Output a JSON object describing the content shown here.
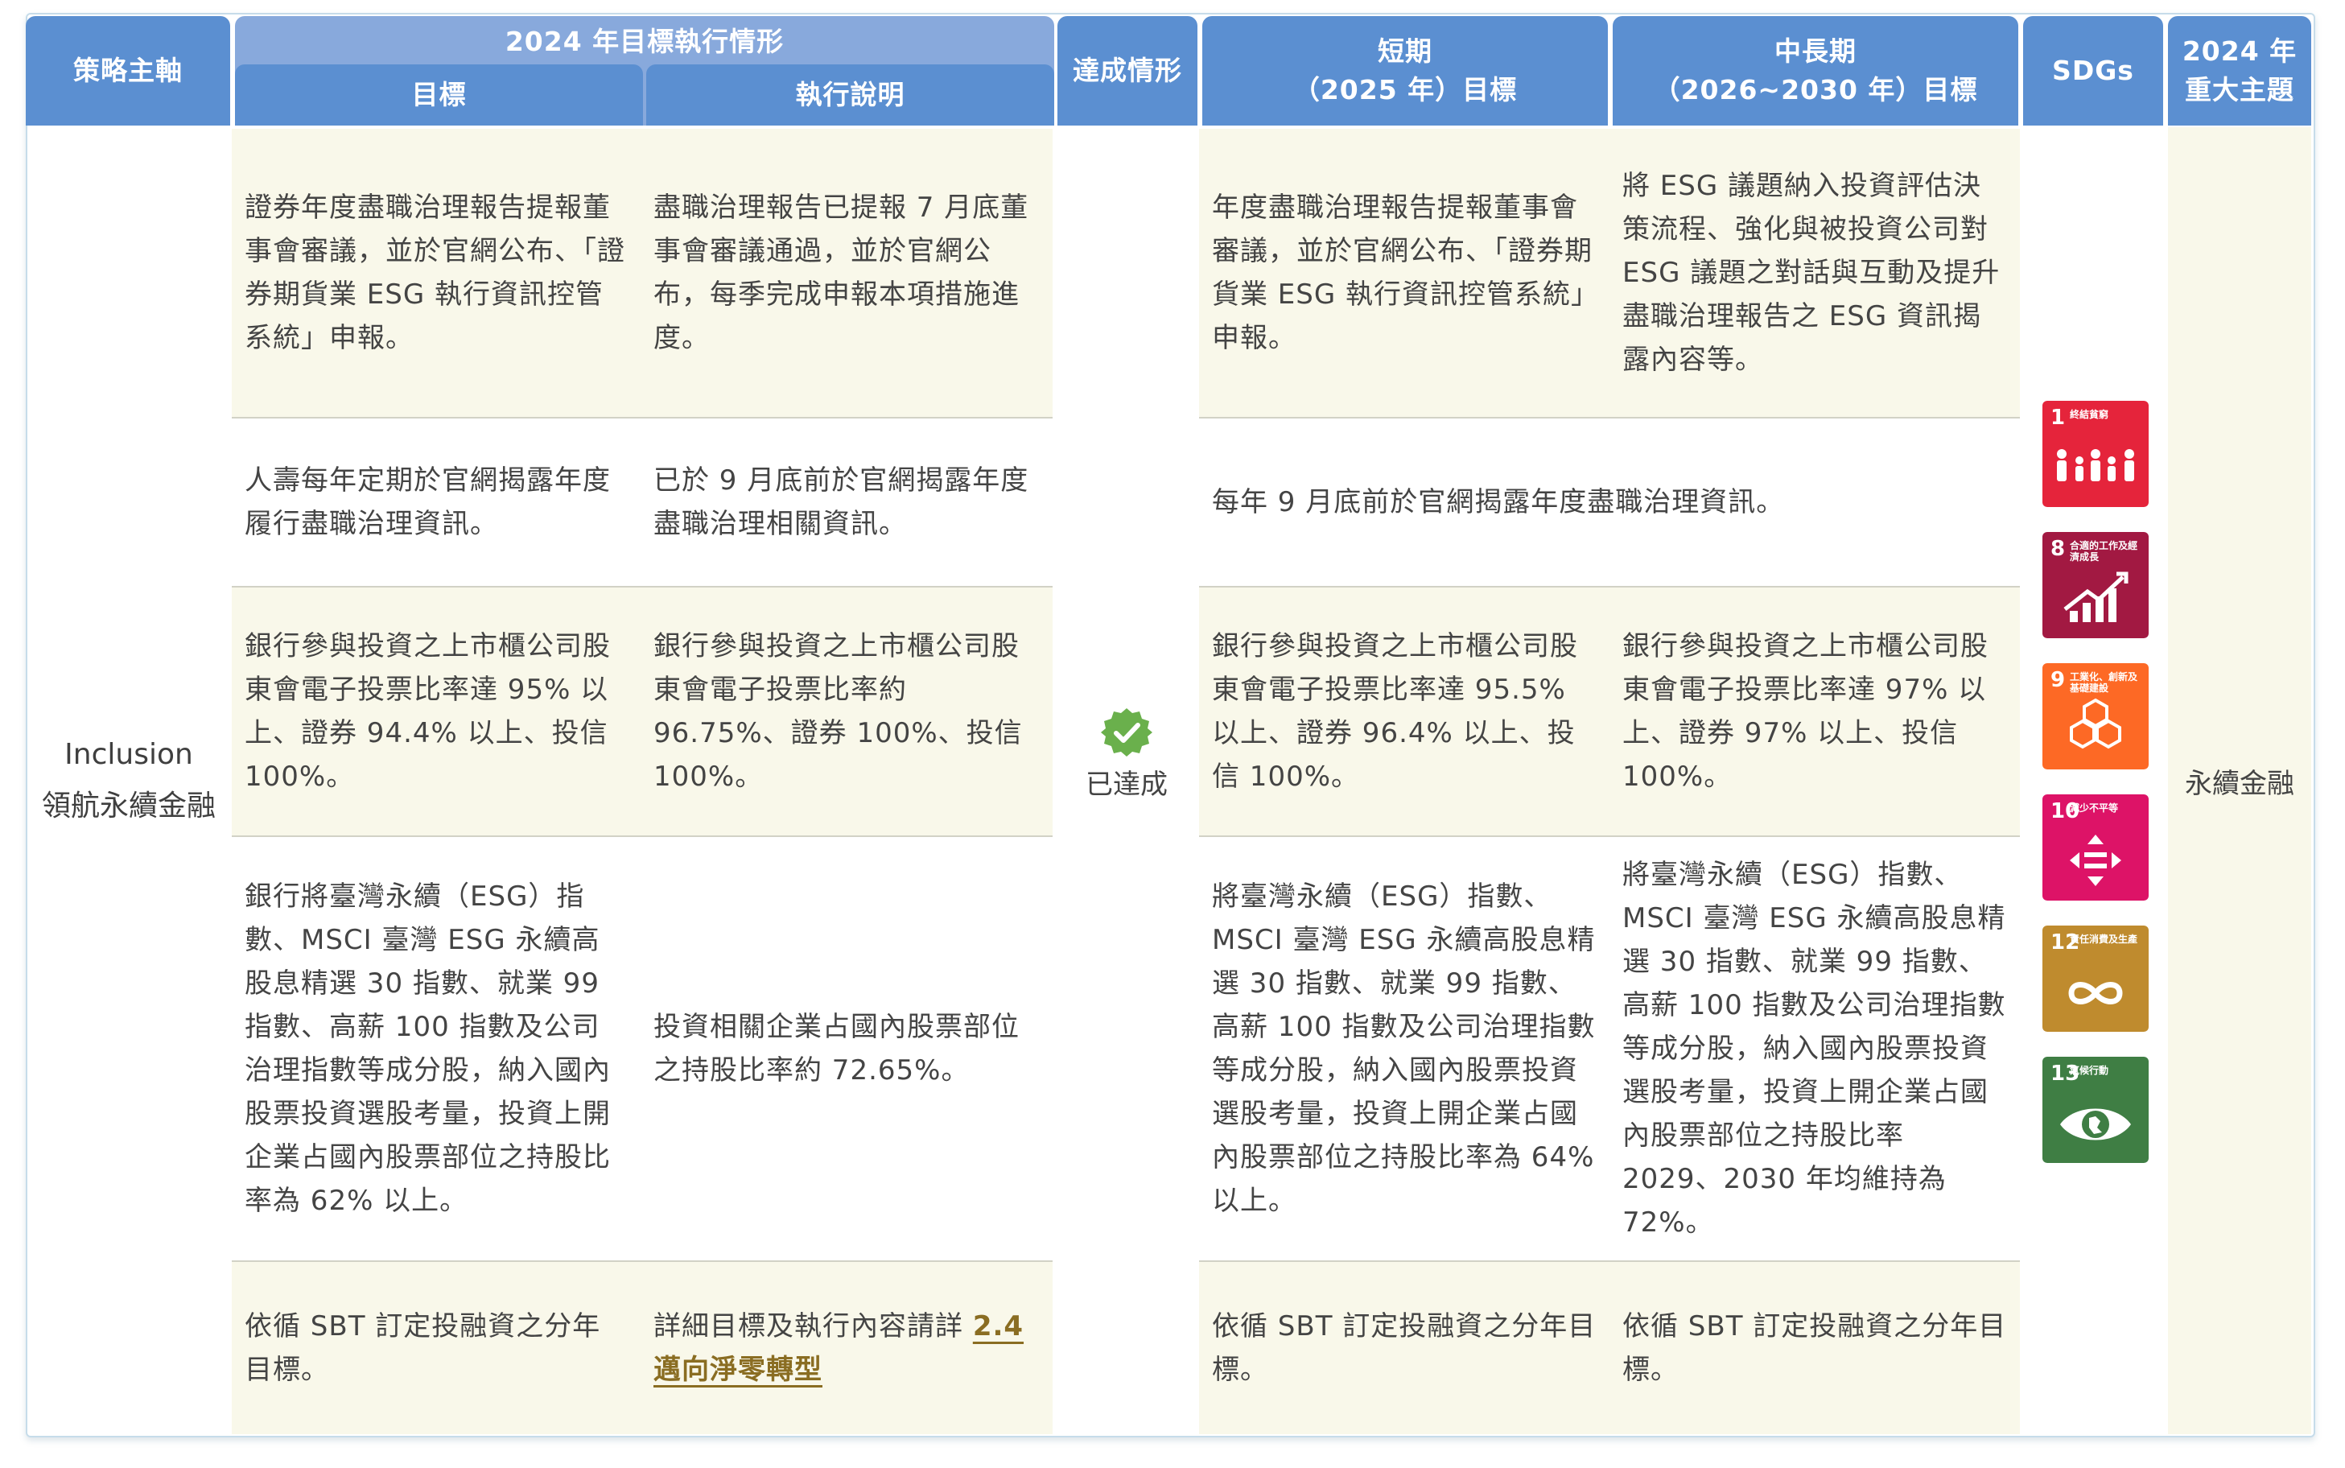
{
  "headers": {
    "axis": "策略主軸",
    "group_2024": "2024 年目標執行情形",
    "target": "目標",
    "execution": "執行說明",
    "achievement": "達成情形",
    "short_term": "短期\n（2025 年）目標",
    "long_term": "中長期\n（2026~2030 年）目標",
    "sdgs": "SDGs",
    "theme": "2024 年\n重大主題"
  },
  "axis": {
    "en": "Inclusion",
    "zh": "領航永續金融"
  },
  "achievement": {
    "label": "已達成",
    "icon": "check-badge-icon",
    "color": "#6ab04c"
  },
  "theme": "永續金融",
  "rows": [
    {
      "target": "證券年度盡職治理報告提報董事會審議，並於官網公布、「證券期貨業 ESG 執行資訊控管系統」申報。",
      "execution": "盡職治理報告已提報 7 月底董事會審議通過，並於官網公布，每季完成申報本項措施進度。",
      "short": "年度盡職治理報告提報董事會審議，並於官網公布、「證券期貨業 ESG 執行資訊控管系統」申報。",
      "long": "將 ESG 議題納入投資評估決策流程、強化與被投資公司對 ESG 議題之對話與互動及提升盡職治理報告之 ESG 資訊揭露內容等。"
    },
    {
      "target": "人壽每年定期於官網揭露年度履行盡職治理資訊。",
      "execution": "已於 9 月底前於官網揭露年度盡職治理相關資訊。",
      "merged": "每年 9 月底前於官網揭露年度盡職治理資訊。"
    },
    {
      "target": "銀行參與投資之上市櫃公司股東會電子投票比率達 95% 以上、證券 94.4% 以上、投信 100%。",
      "execution": "銀行參與投資之上市櫃公司股東會電子投票比率約 96.75%、證券 100%、投信 100%。",
      "short": "銀行參與投資之上市櫃公司股東會電子投票比率達 95.5% 以上、證券 96.4% 以上、投信 100%。",
      "long": "銀行參與投資之上市櫃公司股東會電子投票比率達 97% 以上、證券 97% 以上、投信 100%。"
    },
    {
      "target": "銀行將臺灣永續（ESG）指數、MSCI 臺灣 ESG 永續高股息精選 30 指數、就業 99 指數、高薪 100 指數及公司治理指數等成分股，納入國內股票投資選股考量，投資上開企業占國內股票部位之持股比率為 62% 以上。",
      "execution": "投資相關企業占國內股票部位之持股比率約 72.65%。",
      "short": "將臺灣永續（ESG）指數、MSCI 臺灣 ESG 永續高股息精選 30 指數、就業 99 指數、高薪 100 指數及公司治理指數等成分股，納入國內股票投資選股考量，投資上開企業占國內股票部位之持股比率為 64% 以上。",
      "long": "將臺灣永續（ESG）指數、MSCI 臺灣 ESG 永續高股息精選 30 指數、就業 99 指數、高薪 100 指數及公司治理指數等成分股，納入國內股票投資選股考量，投資上開企業占國內股票部位之持股比率 2029、2030 年均維持為 72%。"
    },
    {
      "target": "依循 SBT 訂定投融資之分年目標。",
      "execution_prefix": "詳細目標及執行內容請詳 ",
      "execution_link": "2.4 邁向淨零轉型",
      "short": "依循 SBT 訂定投融資之分年目標。",
      "long": "依循 SBT 訂定投融資之分年目標。"
    }
  ],
  "sdgs": [
    {
      "num": "1",
      "label": "終結貧窮",
      "color": "#e5243b",
      "icon": "people-icon"
    },
    {
      "num": "8",
      "label": "合適的工作及經濟成長",
      "color": "#a21942",
      "icon": "growth-chart-icon"
    },
    {
      "num": "9",
      "label": "工業化、創新及基礎建設",
      "color": "#fd6925",
      "icon": "cubes-icon"
    },
    {
      "num": "10",
      "label": "減少不平等",
      "color": "#dd1367",
      "icon": "equality-icon"
    },
    {
      "num": "12",
      "label": "責任消費及生產",
      "color": "#bf8b2e",
      "icon": "infinity-icon"
    },
    {
      "num": "13",
      "label": "氣候行動",
      "color": "#3f7e44",
      "icon": "eye-earth-icon"
    }
  ]
}
